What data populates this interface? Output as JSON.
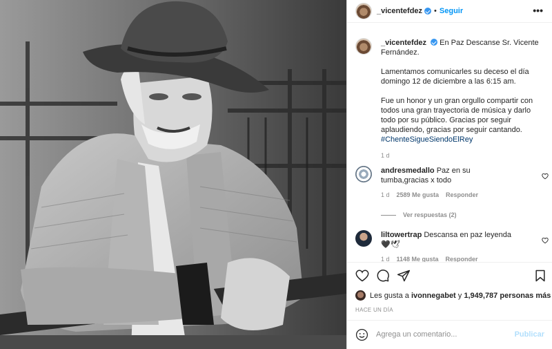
{
  "post": {
    "username": "_vicentefdez",
    "follow_label": "Seguir",
    "separator": "•",
    "more_label": "•••"
  },
  "caption": {
    "username": "_vicentefdez",
    "line1": "En Paz Descanse Sr. Vicente Fernández.",
    "para2": "Lamentamos comunicarles su deceso el día domingo 12 de diciembre a las 6:15 am.",
    "para3": "Fue un honor y un gran orgullo compartir con todos una gran trayectoria de música y darlo todo por su público. Gracias por seguir aplaudiendo, gracias por seguir cantando.",
    "hashtag": "#ChenteSigueSiendoElRey",
    "time": "1 d"
  },
  "comments": [
    {
      "username": "andresmedallo",
      "text": "Paz en su tumba,gracias x todo",
      "time": "1 d",
      "likes": "2589 Me gusta",
      "reply": "Responder"
    },
    {
      "username": "liltowertrap",
      "text": "Descansa en paz leyenda 🖤🕊",
      "time": "1 d",
      "likes": "1148 Me gusta",
      "reply": "Responder"
    }
  ],
  "view_replies": "Ver respuestas (2)",
  "likes": {
    "prefix": "Les gusta a",
    "user": "ivonnegabet",
    "middle": "y",
    "count": "1,949,787 personas más"
  },
  "timestamp": "HACE UN DÍA",
  "add_comment": {
    "placeholder": "Agrega un comentario...",
    "publish": "Publicar"
  },
  "colors": {
    "accent": "#0095f6",
    "hashtag": "#00376b",
    "publish_disabled": "#b2dffc",
    "verified": "#3897f0"
  }
}
